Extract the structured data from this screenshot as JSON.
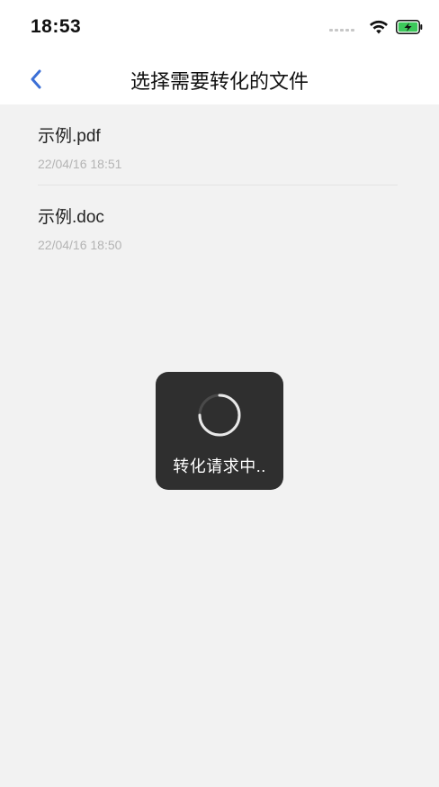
{
  "status_bar": {
    "time": "18:53"
  },
  "header": {
    "title": "选择需要转化的文件",
    "back_icon": "chevron-left-icon"
  },
  "files": [
    {
      "name": "示例.pdf",
      "date": "22/04/16 18:51"
    },
    {
      "name": "示例.doc",
      "date": "22/04/16 18:50"
    }
  ],
  "loading": {
    "text": "转化请求中.."
  },
  "colors": {
    "accent": "#3b6fd6",
    "background": "#f2f2f2",
    "toast": "#2f2f2f",
    "battery": "#3cc85a"
  }
}
